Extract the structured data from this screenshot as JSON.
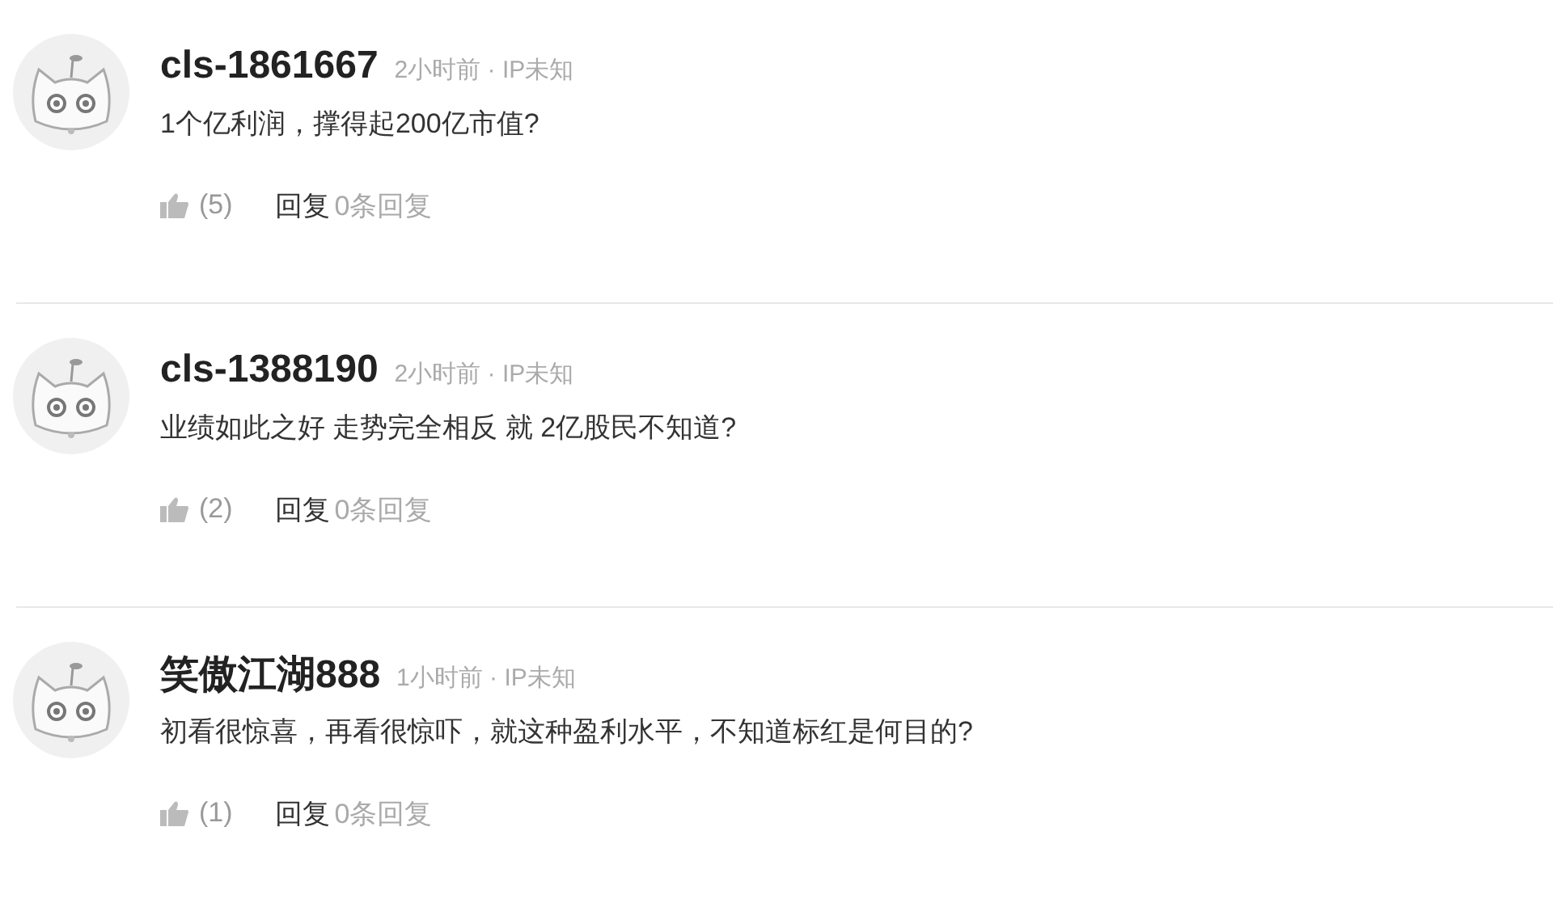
{
  "comments": [
    {
      "user": "cls-1861667",
      "meta": "2小时前 · IP未知",
      "text": "1个亿利润，撑得起200亿市值?",
      "likes": "(5)",
      "reply": "回复",
      "reply_count": "0条回复"
    },
    {
      "user": "cls-1388190",
      "meta": "2小时前 · IP未知",
      "text": "业绩如此之好 走势完全相反 就 2亿股民不知道?",
      "likes": "(2)",
      "reply": "回复",
      "reply_count": "0条回复"
    },
    {
      "user": "笑傲江湖888",
      "meta": "1小时前 · IP未知",
      "text": "初看很惊喜，再看很惊吓，就这种盈利水平，不知道标红是何目的?",
      "likes": "(1)",
      "reply": "回复",
      "reply_count": "0条回复"
    }
  ]
}
